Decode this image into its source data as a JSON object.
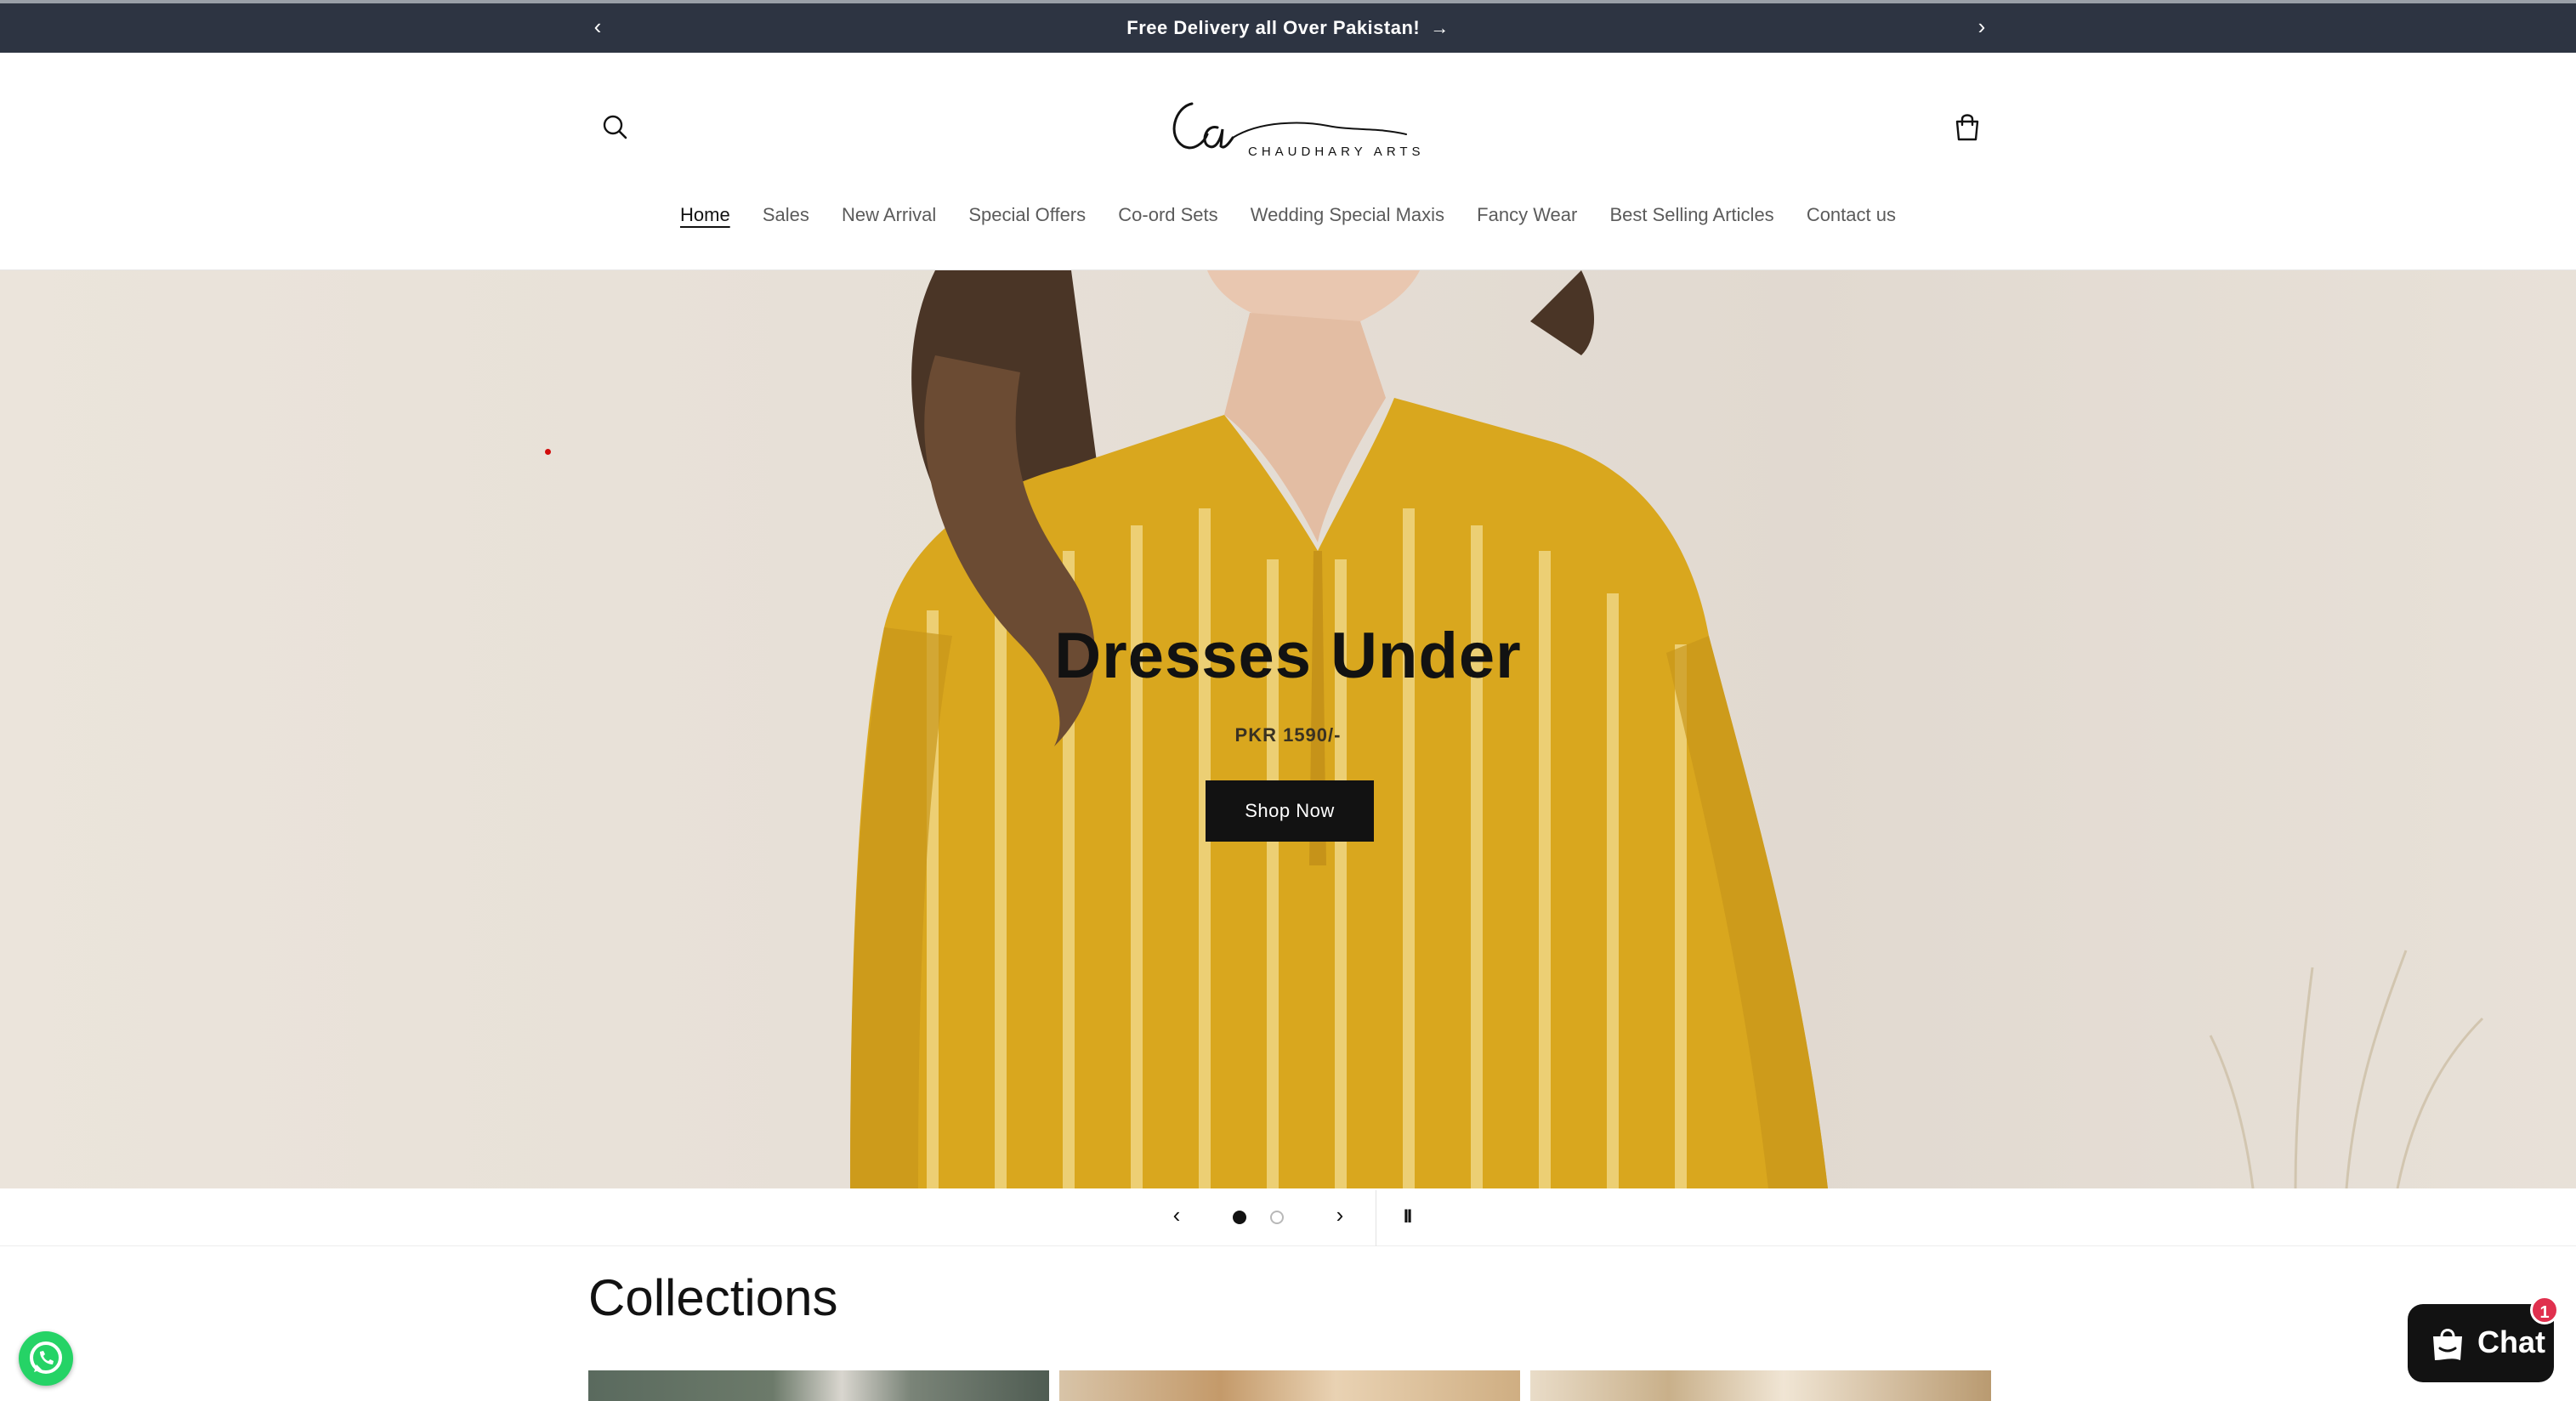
{
  "announcement": {
    "message": "Free Delivery all Over Pakistan!",
    "arrow": "→",
    "prev_icon": "chevron-left-icon",
    "next_icon": "chevron-right-icon",
    "prev_glyph": "‹",
    "next_glyph": "›"
  },
  "header": {
    "logo_text": "CHAUDHARY ARTS",
    "search_icon": "search-icon",
    "cart_icon": "cart-icon"
  },
  "nav": {
    "items": [
      {
        "label": "Home",
        "active": true
      },
      {
        "label": "Sales"
      },
      {
        "label": "New Arrival"
      },
      {
        "label": "Special Offers"
      },
      {
        "label": "Co-ord Sets"
      },
      {
        "label": "Wedding Special Maxis"
      },
      {
        "label": "Fancy Wear"
      },
      {
        "label": "Best Selling Articles"
      },
      {
        "label": "Contact us"
      }
    ]
  },
  "hero": {
    "title": "Dresses Under",
    "subtitle": "PKR 1590/-",
    "button": "Shop Now"
  },
  "slider": {
    "prev_glyph": "‹",
    "next_glyph": "›",
    "pause_glyph": "II",
    "current_slide": 1,
    "total_slides": 2
  },
  "collections": {
    "title": "Collections"
  },
  "chat": {
    "label": "Chat",
    "badge": "1"
  },
  "colors": {
    "announcement_bg": "#2d3442",
    "button_bg": "#121212",
    "badge": "#e0304e",
    "whatsapp": "#25d366"
  }
}
